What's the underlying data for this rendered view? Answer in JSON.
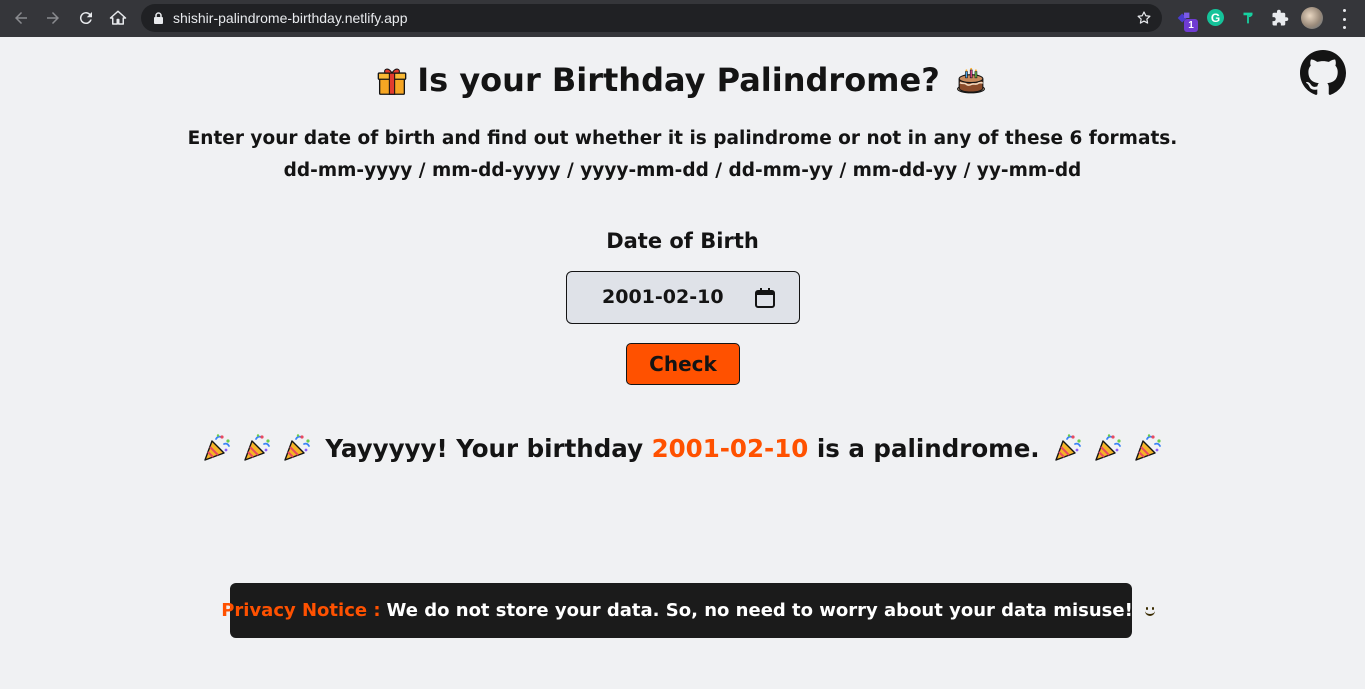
{
  "browser": {
    "url": "shishir-palindrome-birthday.netlify.app",
    "extension_badge": "1",
    "grammarly_letter": "G"
  },
  "page": {
    "title": "Is your Birthday Palindrome?",
    "subtitle_line1": "Enter your date of birth and find out whether it is palindrome or not in any of these 6 formats.",
    "subtitle_line2": "dd-mm-yyyy / mm-dd-yyyy / yyyy-mm-dd / dd-mm-yy / mm-dd-yy / yy-mm-dd",
    "dob_label": "Date of Birth",
    "dob_value": "2001-02-10",
    "check_label": "Check",
    "result_prefix": "Yayyyyy! Your birthday",
    "result_date": "2001-02-10",
    "result_suffix": "is a palindrome.",
    "privacy_label": "Privacy Notice :",
    "privacy_text": "We do not store your data. So, no need to worry about your data misuse!"
  },
  "icons": {
    "title_left": "gift-icon",
    "title_right": "cake-icon",
    "celebration": "party-popper-icon",
    "github": "github-icon",
    "calendar": "calendar-icon"
  },
  "colors": {
    "accent": "#ff5100",
    "background": "#f0f1f3",
    "text": "#141414",
    "privacy_bg": "#1b1b1b"
  }
}
